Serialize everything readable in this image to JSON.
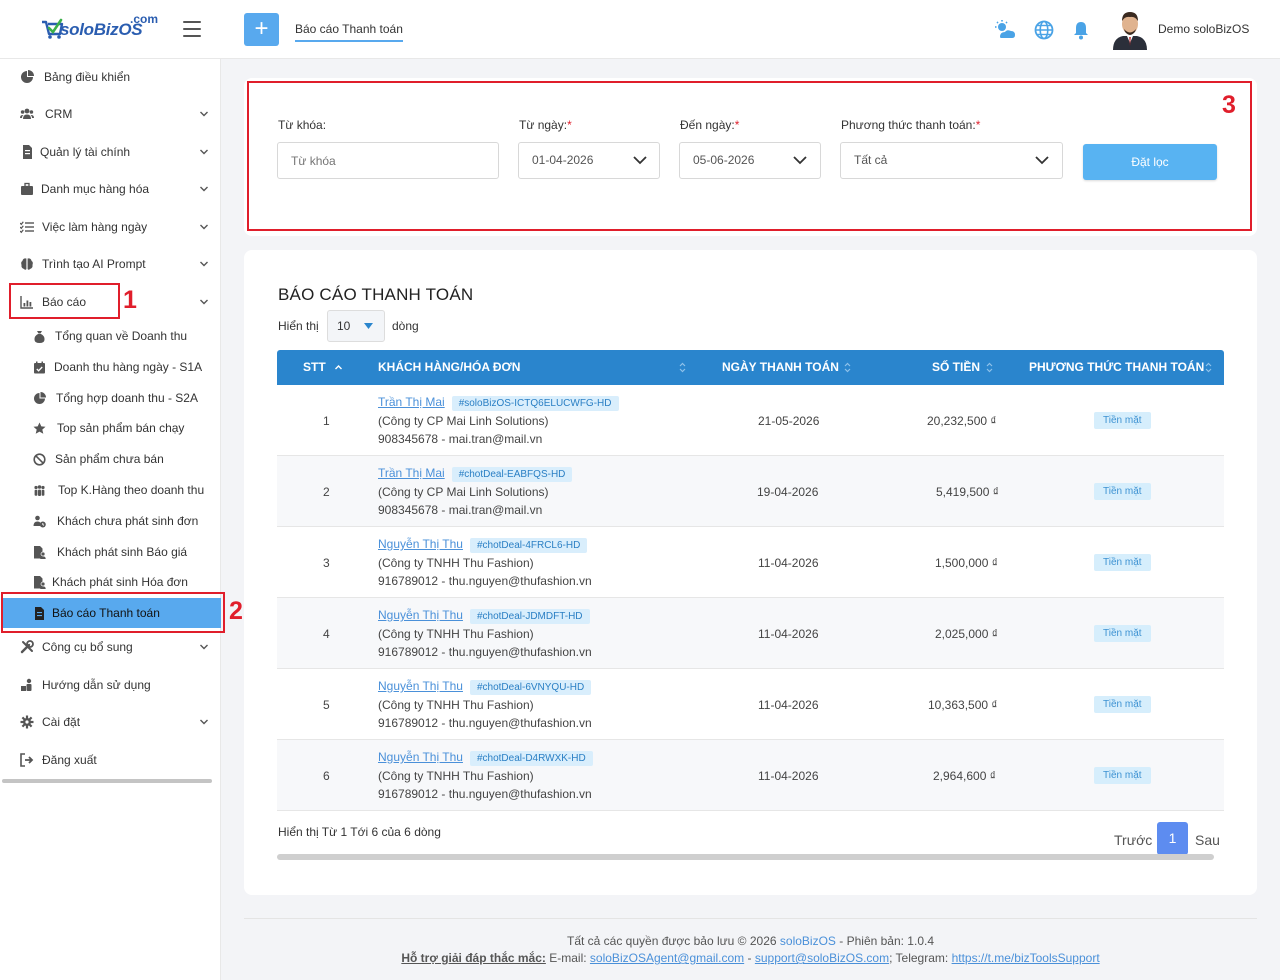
{
  "header": {
    "logo_text": "soloBizOS",
    "logo_suffix": ".com",
    "page_tab": "Báo cáo Thanh toán",
    "user_name": "Demo soloBizOS"
  },
  "sidebar": {
    "items": [
      {
        "label": "Bảng điều khiển"
      },
      {
        "label": "CRM"
      },
      {
        "label": "Quản lý tài chính"
      },
      {
        "label": "Danh mục hàng hóa"
      },
      {
        "label": "Việc làm hàng ngày"
      },
      {
        "label": "Trình tạo AI Prompt"
      },
      {
        "label": "Báo cáo"
      },
      {
        "label": "Công cụ bổ sung"
      },
      {
        "label": "Hướng dẫn sử dụng"
      },
      {
        "label": "Cài đặt"
      },
      {
        "label": "Đăng xuất"
      }
    ],
    "report_subitems": [
      {
        "label": "Tổng quan về Doanh thu"
      },
      {
        "label": "Doanh thu hàng ngày - S1A"
      },
      {
        "label": "Tổng hợp doanh thu - S2A"
      },
      {
        "label": "Top sản phẩm bán chạy"
      },
      {
        "label": "Sản phẩm chưa bán"
      },
      {
        "label": "Top K.Hàng theo doanh thu"
      },
      {
        "label": "Khách chưa phát sinh đơn"
      },
      {
        "label": "Khách phát sinh Báo giá"
      },
      {
        "label": "Khách phát sinh Hóa đơn"
      },
      {
        "label": "Báo cáo Thanh toán"
      }
    ]
  },
  "annotations": {
    "one": "1",
    "two": "2",
    "three": "3"
  },
  "filter": {
    "keyword_label": "Từ khóa:",
    "keyword_placeholder": "Từ khóa",
    "from_label": "Từ ngày:",
    "from_value": "01-04-2026",
    "to_label": "Đến ngày:",
    "to_value": "05-06-2026",
    "method_label": "Phương thức thanh toán:",
    "method_value": "Tất cả",
    "required_mark": "*",
    "button_label": "Đặt lọc"
  },
  "report": {
    "title": "BÁO CÁO THANH TOÁN",
    "show_label": "Hiển thị",
    "page_size": "10",
    "rows_label": "dòng",
    "columns": [
      "STT",
      "KHÁCH HÀNG/HÓA ĐƠN",
      "NGÀY THANH TOÁN",
      "SỐ TIỀN",
      "PHƯƠNG THỨC THANH TOÁN"
    ],
    "rows": [
      {
        "stt": "1",
        "customer": "Trần Thị Mai",
        "invoice": "#soloBizOS-ICTQ6ELUCWFG-HD",
        "company": "(Công ty CP Mai Linh Solutions)",
        "contact": "908345678 - mai.tran@mail.vn",
        "date": "21-05-2026",
        "amount": "20,232,500 ₫",
        "method": "Tiền mặt"
      },
      {
        "stt": "2",
        "customer": "Trần Thị Mai",
        "invoice": "#chotDeal-EABFQS-HD",
        "company": "(Công ty CP Mai Linh Solutions)",
        "contact": "908345678 - mai.tran@mail.vn",
        "date": "19-04-2026",
        "amount": "5,419,500 ₫",
        "method": "Tiền mặt"
      },
      {
        "stt": "3",
        "customer": "Nguyễn Thị Thu",
        "invoice": "#chotDeal-4FRCL6-HD",
        "company": "(Công ty TNHH Thu Fashion)",
        "contact": "916789012 - thu.nguyen@thufashion.vn",
        "date": "11-04-2026",
        "amount": "1,500,000 ₫",
        "method": "Tiền mặt"
      },
      {
        "stt": "4",
        "customer": "Nguyễn Thị Thu",
        "invoice": "#chotDeal-JDMDFT-HD",
        "company": "(Công ty TNHH Thu Fashion)",
        "contact": "916789012 - thu.nguyen@thufashion.vn",
        "date": "11-04-2026",
        "amount": "2,025,000 ₫",
        "method": "Tiền mặt"
      },
      {
        "stt": "5",
        "customer": "Nguyễn Thị Thu",
        "invoice": "#chotDeal-6VNYQU-HD",
        "company": "(Công ty TNHH Thu Fashion)",
        "contact": "916789012 - thu.nguyen@thufashion.vn",
        "date": "11-04-2026",
        "amount": "10,363,500 ₫",
        "method": "Tiền mặt"
      },
      {
        "stt": "6",
        "customer": "Nguyễn Thị Thu",
        "invoice": "#chotDeal-D4RWXK-HD",
        "company": "(Công ty TNHH Thu Fashion)",
        "contact": "916789012 - thu.nguyen@thufashion.vn",
        "date": "11-04-2026",
        "amount": "2,964,600 ₫",
        "method": "Tiền mặt"
      }
    ],
    "info": "Hiển thị Từ 1 Tới 6 của 6 dòng",
    "prev": "Trước",
    "page": "1",
    "next": "Sau"
  },
  "footer": {
    "copyright": "Tất cả các quyền được bảo lưu © 2026",
    "brand": "soloBizOS",
    "version": "- Phiên bản: 1.0.4",
    "support_label": "Hỗ trợ giải đáp thắc mắc:",
    "email_label": "E-mail:",
    "email1": "soloBizOSAgent@gmail.com",
    "sep": "-",
    "email2": "support@soloBizOS.com",
    "telegram_label": "; Telegram:",
    "telegram": "https://t.me/bizToolsSupport"
  },
  "colors": {
    "accent": "#58a9ee",
    "table_header": "#2a85cd",
    "highlight": "#e01e2b",
    "link": "#4a90d9"
  }
}
